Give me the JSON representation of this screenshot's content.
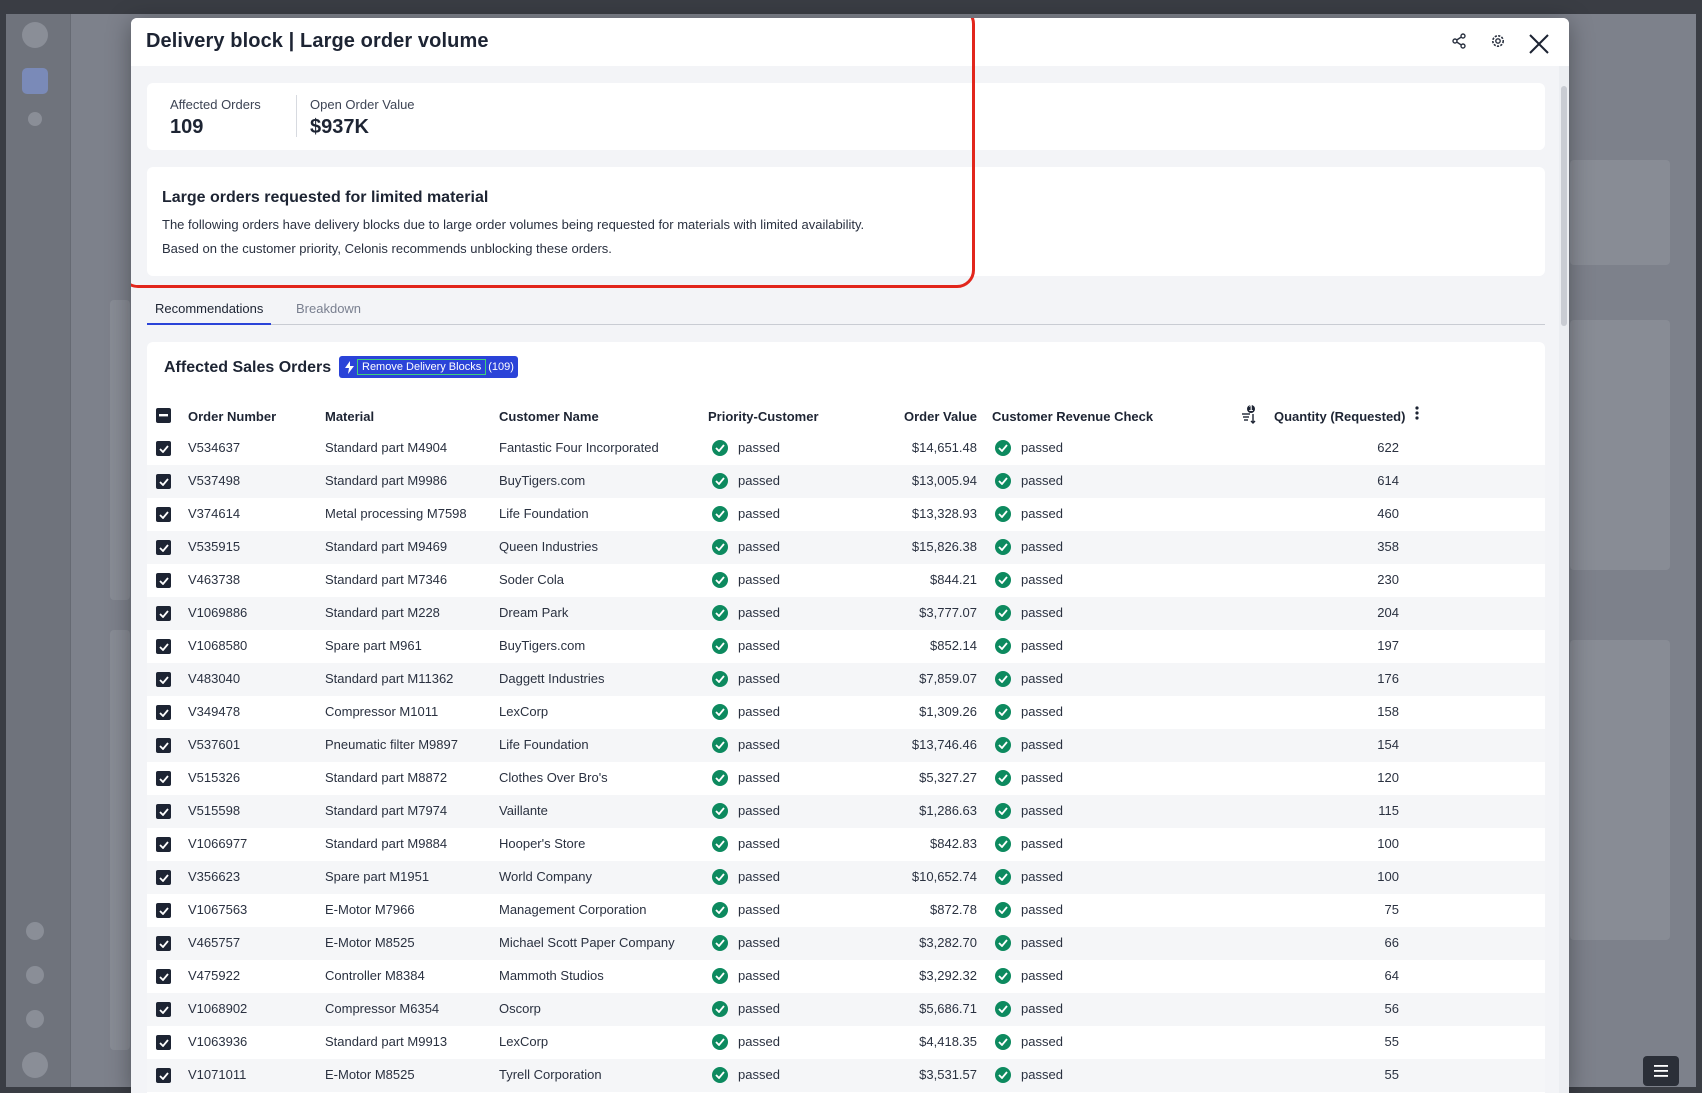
{
  "modal": {
    "title": "Delivery block | Large order volume"
  },
  "kpis": [
    {
      "label": "Affected Orders",
      "value": "109"
    },
    {
      "label": "Open Order Value",
      "value": "$937K"
    }
  ],
  "description": {
    "title": "Large orders requested for limited material",
    "line1": "The following orders have delivery blocks due to large order volumes being requested for materials with limited availability.",
    "line2": "Based on the customer priority, Celonis recommends unblocking these orders."
  },
  "tabs": [
    {
      "label": "Recommendations",
      "active": true
    },
    {
      "label": "Breakdown",
      "active": false
    }
  ],
  "table": {
    "title": "Affected Sales Orders",
    "action_label": "Remove Delivery Blocks",
    "action_count": "(109)",
    "sort_badge": "1",
    "columns": {
      "order_number": "Order Number",
      "material": "Material",
      "customer_name": "Customer Name",
      "priority_customer": "Priority-Customer",
      "order_value": "Order Value",
      "revenue_check": "Customer Revenue Check",
      "quantity": "Quantity (Requested)"
    },
    "rows": [
      {
        "order": "V534637",
        "material": "Standard part M4904",
        "customer": "Fantastic Four Incorporated",
        "priority": "passed",
        "value": "$14,651.48",
        "revenue": "passed",
        "qty": "622"
      },
      {
        "order": "V537498",
        "material": "Standard part M9986",
        "customer": "BuyTigers.com",
        "priority": "passed",
        "value": "$13,005.94",
        "revenue": "passed",
        "qty": "614"
      },
      {
        "order": "V374614",
        "material": "Metal processing M7598",
        "customer": "Life Foundation",
        "priority": "passed",
        "value": "$13,328.93",
        "revenue": "passed",
        "qty": "460"
      },
      {
        "order": "V535915",
        "material": "Standard part M9469",
        "customer": "Queen Industries",
        "priority": "passed",
        "value": "$15,826.38",
        "revenue": "passed",
        "qty": "358"
      },
      {
        "order": "V463738",
        "material": "Standard part M7346",
        "customer": "Soder Cola",
        "priority": "passed",
        "value": "$844.21",
        "revenue": "passed",
        "qty": "230"
      },
      {
        "order": "V1069886",
        "material": "Standard part M228",
        "customer": "Dream Park",
        "priority": "passed",
        "value": "$3,777.07",
        "revenue": "passed",
        "qty": "204"
      },
      {
        "order": "V1068580",
        "material": "Spare part M961",
        "customer": "BuyTigers.com",
        "priority": "passed",
        "value": "$852.14",
        "revenue": "passed",
        "qty": "197"
      },
      {
        "order": "V483040",
        "material": "Standard part M11362",
        "customer": "Daggett Industries",
        "priority": "passed",
        "value": "$7,859.07",
        "revenue": "passed",
        "qty": "176"
      },
      {
        "order": "V349478",
        "material": "Compressor M1011",
        "customer": "LexCorp",
        "priority": "passed",
        "value": "$1,309.26",
        "revenue": "passed",
        "qty": "158"
      },
      {
        "order": "V537601",
        "material": "Pneumatic filter M9897",
        "customer": "Life Foundation",
        "priority": "passed",
        "value": "$13,746.46",
        "revenue": "passed",
        "qty": "154"
      },
      {
        "order": "V515326",
        "material": "Standard part M8872",
        "customer": "Clothes Over Bro's",
        "priority": "passed",
        "value": "$5,327.27",
        "revenue": "passed",
        "qty": "120"
      },
      {
        "order": "V515598",
        "material": "Standard part M7974",
        "customer": "Vaillante",
        "priority": "passed",
        "value": "$1,286.63",
        "revenue": "passed",
        "qty": "115"
      },
      {
        "order": "V1066977",
        "material": "Standard part M9884",
        "customer": "Hooper's Store",
        "priority": "passed",
        "value": "$842.83",
        "revenue": "passed",
        "qty": "100"
      },
      {
        "order": "V356623",
        "material": "Spare part M1951",
        "customer": "World Company",
        "priority": "passed",
        "value": "$10,652.74",
        "revenue": "passed",
        "qty": "100"
      },
      {
        "order": "V1067563",
        "material": "E-Motor M7966",
        "customer": "Management Corporation",
        "priority": "passed",
        "value": "$872.78",
        "revenue": "passed",
        "qty": "75"
      },
      {
        "order": "V465757",
        "material": "E-Motor M8525",
        "customer": "Michael Scott Paper Company",
        "priority": "passed",
        "value": "$3,282.70",
        "revenue": "passed",
        "qty": "66"
      },
      {
        "order": "V475922",
        "material": "Controller M8384",
        "customer": "Mammoth Studios",
        "priority": "passed",
        "value": "$3,292.32",
        "revenue": "passed",
        "qty": "64"
      },
      {
        "order": "V1068902",
        "material": "Compressor M6354",
        "customer": "Oscorp",
        "priority": "passed",
        "value": "$5,686.71",
        "revenue": "passed",
        "qty": "56"
      },
      {
        "order": "V1063936",
        "material": "Standard part M9913",
        "customer": "LexCorp",
        "priority": "passed",
        "value": "$4,418.35",
        "revenue": "passed",
        "qty": "55"
      },
      {
        "order": "V1071011",
        "material": "E-Motor M8525",
        "customer": "Tyrell Corporation",
        "priority": "passed",
        "value": "$3,531.57",
        "revenue": "passed",
        "qty": "55"
      }
    ]
  },
  "colors": {
    "accent": "#2a43d8",
    "status_passed": "#0d8a5f",
    "highlight": "#e2261c",
    "text_dark": "#1d2433"
  },
  "icons": {
    "share": "share-icon",
    "settings": "gear-icon",
    "close": "close-icon",
    "bolt": "lightning-icon",
    "check": "checkmark-icon",
    "sort": "sort-icon",
    "more": "more-vertical-icon",
    "menu": "menu-icon"
  }
}
